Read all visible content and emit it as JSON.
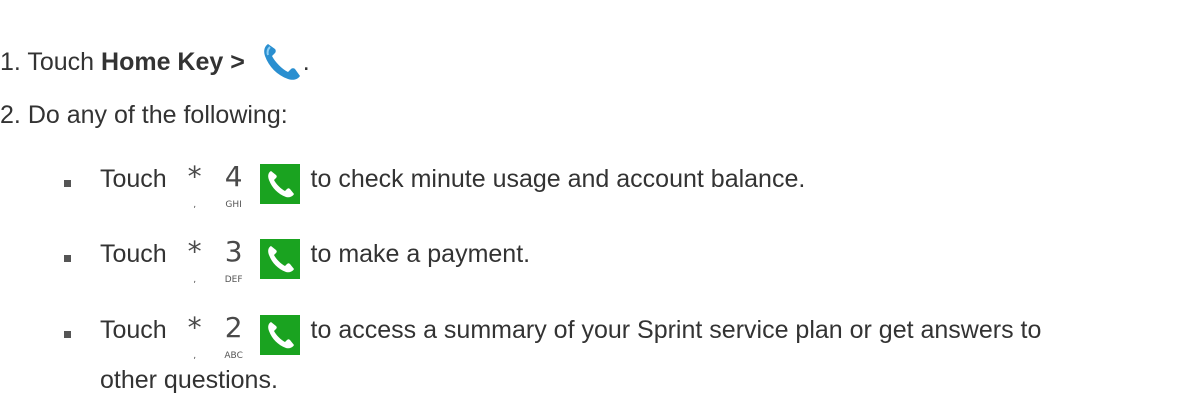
{
  "steps": [
    {
      "number": "1.",
      "pre": "Touch ",
      "bold": "Home Key > ",
      "post": "."
    },
    {
      "number": "2.",
      "text": "Do any of the following:"
    }
  ],
  "bullets": [
    {
      "pre": "Touch",
      "keys": [
        {
          "big": "*",
          "small": ","
        },
        {
          "big": "4",
          "small": "GHI"
        }
      ],
      "post": "to check minute usage and account balance."
    },
    {
      "pre": "Touch",
      "keys": [
        {
          "big": "*",
          "small": ","
        },
        {
          "big": "3",
          "small": "DEF"
        }
      ],
      "post": "to make a payment."
    },
    {
      "pre": "Touch",
      "keys": [
        {
          "big": "*",
          "small": ","
        },
        {
          "big": "2",
          "small": "ABC"
        }
      ],
      "post": "to access a summary of your Sprint service plan or get answers to",
      "continuation": "other questions."
    }
  ],
  "icons": {
    "phone": "phone-icon",
    "call": "call-button-icon"
  },
  "colors": {
    "text": "#333333",
    "call_green": "#1aa320",
    "phone_blue": "#2a8fd0"
  }
}
